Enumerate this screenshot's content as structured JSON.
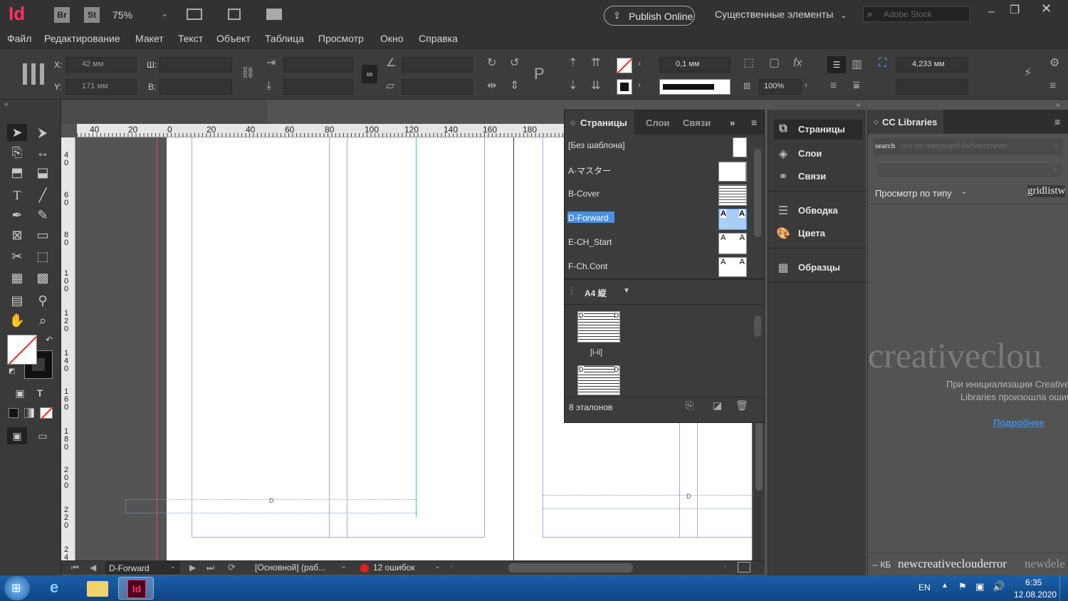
{
  "app": {
    "logo": "Id",
    "bridge": "Br",
    "stock_app": "St",
    "zoom": "75%",
    "publish_online": "Publish Online",
    "workspace": "Существенные элементы",
    "search_placeholder": "Adobe Stock"
  },
  "menu": [
    "Файл",
    "Редактирование",
    "Макет",
    "Текст",
    "Объект",
    "Таблица",
    "Просмотр",
    "Окно",
    "Справка"
  ],
  "control": {
    "x_label": "X:",
    "x_value": "42 мм",
    "y_label": "Y:",
    "y_value": "171 мм",
    "w_label": "Ш:",
    "h_label": "В:",
    "stroke_weight": "0,1 мм",
    "opacity": "100%",
    "gutter": "4,233 мм"
  },
  "ruler": {
    "top": [
      "40",
      "20",
      "0",
      "20",
      "40",
      "60",
      "80",
      "100",
      "120",
      "140",
      "160",
      "180"
    ],
    "left": [
      "4\n0",
      "6\n0",
      "8\n0",
      "1\n0\n0",
      "1\n2\n0",
      "1\n4\n0",
      "1\n6\n0",
      "1\n8\n0",
      "2\n0\n0",
      "2\n2\n0",
      "2\n4"
    ]
  },
  "document": {
    "marker_left": "D",
    "marker_right": "D"
  },
  "status": {
    "page": "D-Forward",
    "style": "[Основной] (раб...",
    "errors": "12 ошибок"
  },
  "pages_panel": {
    "tabs": [
      "Страницы",
      "Слои",
      "Связи"
    ],
    "more": "»",
    "masters": [
      "[Без шаблона]",
      "A-マスター",
      "B-Cover",
      "D-Forward",
      "E-CH_Start",
      "F-Ch.Cont"
    ],
    "thumb_letter": "A",
    "page_size": "A4 縦",
    "spread_label": "[i-ii]",
    "page_letter": "D",
    "count": "8 эталонов"
  },
  "dock": {
    "items": [
      "Страницы",
      "Слои",
      "Связи",
      "Обводка",
      "Цвета",
      "Образцы"
    ]
  },
  "cclib": {
    "title": "CC Libraries",
    "search_label": "search",
    "search_placeholder": "иск по текущей библиотеке",
    "view_by": "Просмотр по типу",
    "view_mode": "gridlistw",
    "big_text": "creativeclou",
    "error_line1": "При инициализации Creative",
    "error_line2": "Libraries произошла ошиб",
    "more_link": "Подробнее",
    "footer_kb": "-- КБ",
    "footer_text": "newcreativeclouderror",
    "footer_text2": "newdele"
  },
  "taskbar": {
    "lang": "EN",
    "time": "6:35",
    "date": "12.08.2020",
    "id_logo": "Id"
  },
  "colors": {
    "indesign_pink": "#ff3366",
    "margin_purple": "#b6a2e0",
    "cyan_guide": "#36c9c9",
    "highlight": "#4a90e2",
    "link_blue": "#3c8dde"
  }
}
